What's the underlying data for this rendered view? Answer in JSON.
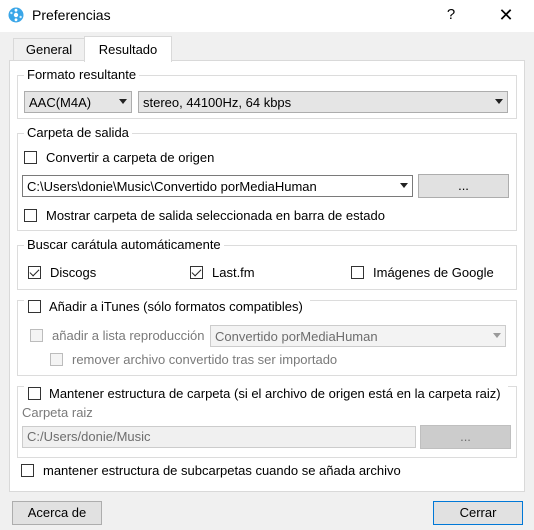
{
  "window": {
    "title": "Preferencias",
    "help_label": "?",
    "close_label": "✕"
  },
  "tabs": [
    "General",
    "Resultado"
  ],
  "output_format": {
    "legend": "Formato resultante",
    "format_value": "AAC(M4A)",
    "quality_value": "stereo, 44100Hz, 64 kbps"
  },
  "output_folder": {
    "legend": "Carpeta de salida",
    "convert_to_source_label": "Convertir a carpeta de origen",
    "convert_to_source_checked": false,
    "path_value": "C:\\Users\\donie\\Music\\Convertido porMediaHuman",
    "browse_label": "...",
    "show_in_status_label": "Mostrar carpeta de salida seleccionada en barra de estado",
    "show_in_status_checked": false
  },
  "artwork": {
    "legend": "Buscar carátula automáticamente",
    "sources": [
      {
        "label": "Discogs",
        "checked": true
      },
      {
        "label": "Last.fm",
        "checked": true
      },
      {
        "label": "Imágenes de Google",
        "checked": false
      }
    ]
  },
  "itunes": {
    "add_label": "Añadir a iTunes (sólo formatos compatibles)",
    "add_checked": false,
    "playlist_label": "añadir a lista reproducción",
    "playlist_value": "Convertido porMediaHuman",
    "remove_label": "remover archivo convertido tras ser importado"
  },
  "folder_structure": {
    "keep_label": "Mantener estructura de carpeta (si el archivo de origen está en la carpeta raiz)",
    "keep_checked": false,
    "root_label": "Carpeta raiz",
    "root_value": "C:/Users/donie/Music",
    "browse_label": "..."
  },
  "subfolders": {
    "label": "mantener estructura de subcarpetas cuando se añada archivo",
    "checked": false
  },
  "footer": {
    "about_label": "Acerca de",
    "close_label": "Cerrar"
  },
  "colors": {
    "accent": "#0078d7",
    "window_bg": "#f0f0f0",
    "panel_bg": "#ffffff"
  }
}
